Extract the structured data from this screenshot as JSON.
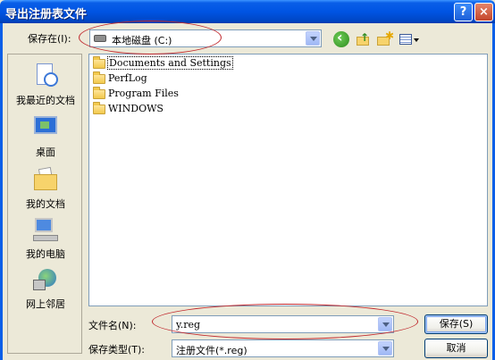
{
  "window": {
    "title": "导出注册表文件",
    "help_glyph": "?",
    "close_glyph": "×"
  },
  "save_in": {
    "label": "保存在(I):",
    "value": "本地磁盘 (C:)"
  },
  "toolbar": {
    "icons": [
      "back-icon",
      "up-folder-icon",
      "new-folder-icon",
      "view-menu-icon"
    ]
  },
  "places": [
    {
      "label": "我最近的文档",
      "icon": "recent-documents-icon"
    },
    {
      "label": "桌面",
      "icon": "desktop-icon"
    },
    {
      "label": "我的文档",
      "icon": "my-documents-icon"
    },
    {
      "label": "我的电脑",
      "icon": "my-computer-icon"
    },
    {
      "label": "网上邻居",
      "icon": "network-places-icon"
    }
  ],
  "files": [
    {
      "name": "Documents and Settings"
    },
    {
      "name": "PerfLog"
    },
    {
      "name": "Program Files"
    },
    {
      "name": "WINDOWS"
    }
  ],
  "filename": {
    "label": "文件名(N):",
    "value": "y.reg"
  },
  "filetype": {
    "label": "保存类型(T):",
    "value": "注册文件(*.reg)"
  },
  "buttons": {
    "save": "保存(S)",
    "cancel": "取消"
  },
  "annotation_color": "#C0282D"
}
